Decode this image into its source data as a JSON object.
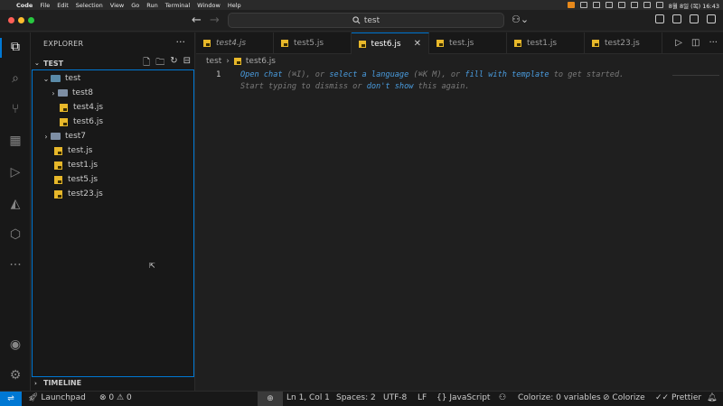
{
  "menubar": {
    "apple": "",
    "app": "Code",
    "items": [
      "File",
      "Edit",
      "Selection",
      "View",
      "Go",
      "Run",
      "Terminal",
      "Window",
      "Help"
    ],
    "clock": "8월 8일 (목) 16:43"
  },
  "titlebar": {
    "search_text": "test",
    "search_icon": "search-icon",
    "back_icon": "arrow-left-icon",
    "forward_icon": "arrow-right-icon"
  },
  "activity_bar": {
    "items": [
      "explorer-icon",
      "search-icon",
      "source-control-icon",
      "extensions-icon",
      "run-debug-icon",
      "prisma-icon",
      "package-icon",
      "more-icon"
    ],
    "bottom": [
      "account-icon",
      "settings-gear-icon"
    ]
  },
  "sidebar": {
    "title": "EXPLORER",
    "more": "···",
    "section": "TEST",
    "timeline": "TIMELINE",
    "tree": [
      {
        "label": "test",
        "type": "folder-open",
        "depth": 1
      },
      {
        "label": "test8",
        "type": "folder",
        "depth": 2
      },
      {
        "label": "test4.js",
        "type": "js",
        "depth": 2
      },
      {
        "label": "test6.js",
        "type": "js",
        "depth": 2
      },
      {
        "label": "test7",
        "type": "folder",
        "depth": 1
      },
      {
        "label": "test.js",
        "type": "js",
        "depth": 1
      },
      {
        "label": "test1.js",
        "type": "js",
        "depth": 1
      },
      {
        "label": "test5.js",
        "type": "js",
        "depth": 1
      },
      {
        "label": "test23.js",
        "type": "js",
        "depth": 1
      }
    ]
  },
  "tabs": [
    {
      "label": "test4.js",
      "italic": true,
      "active": false
    },
    {
      "label": "test5.js",
      "italic": false,
      "active": false
    },
    {
      "label": "test6.js",
      "italic": false,
      "active": true
    },
    {
      "label": "test.js",
      "italic": false,
      "active": false
    },
    {
      "label": "test1.js",
      "italic": false,
      "active": false
    },
    {
      "label": "test23.js",
      "italic": false,
      "active": false
    }
  ],
  "breadcrumb": {
    "folder": "test",
    "file": "test6.js"
  },
  "editor": {
    "line_number": "1",
    "hint1": {
      "link1": "Open chat",
      "text1": " (⌘I), or ",
      "link2": "select a language",
      "text2": " (⌘K M), or ",
      "link3": "fill with template",
      "text3": " to get started."
    },
    "hint2": {
      "text1": "Start typing to dismiss or ",
      "link1": "don't show",
      "text2": " this again."
    }
  },
  "statusbar": {
    "launchpad": "Launchpad",
    "errors": "0",
    "warnings": "0",
    "position": "Ln 1, Col 1",
    "spaces": "Spaces: 2",
    "encoding": "UTF-8",
    "eol": "LF",
    "language": "JavaScript",
    "colorize_vars": "Colorize: 0 variables",
    "colorize": "Colorize",
    "prettier": "Prettier"
  },
  "colors": {
    "accent": "#0078d4",
    "background": "#1f1f1f",
    "sidebar": "#181818",
    "js_icon": "#e8b82a"
  }
}
